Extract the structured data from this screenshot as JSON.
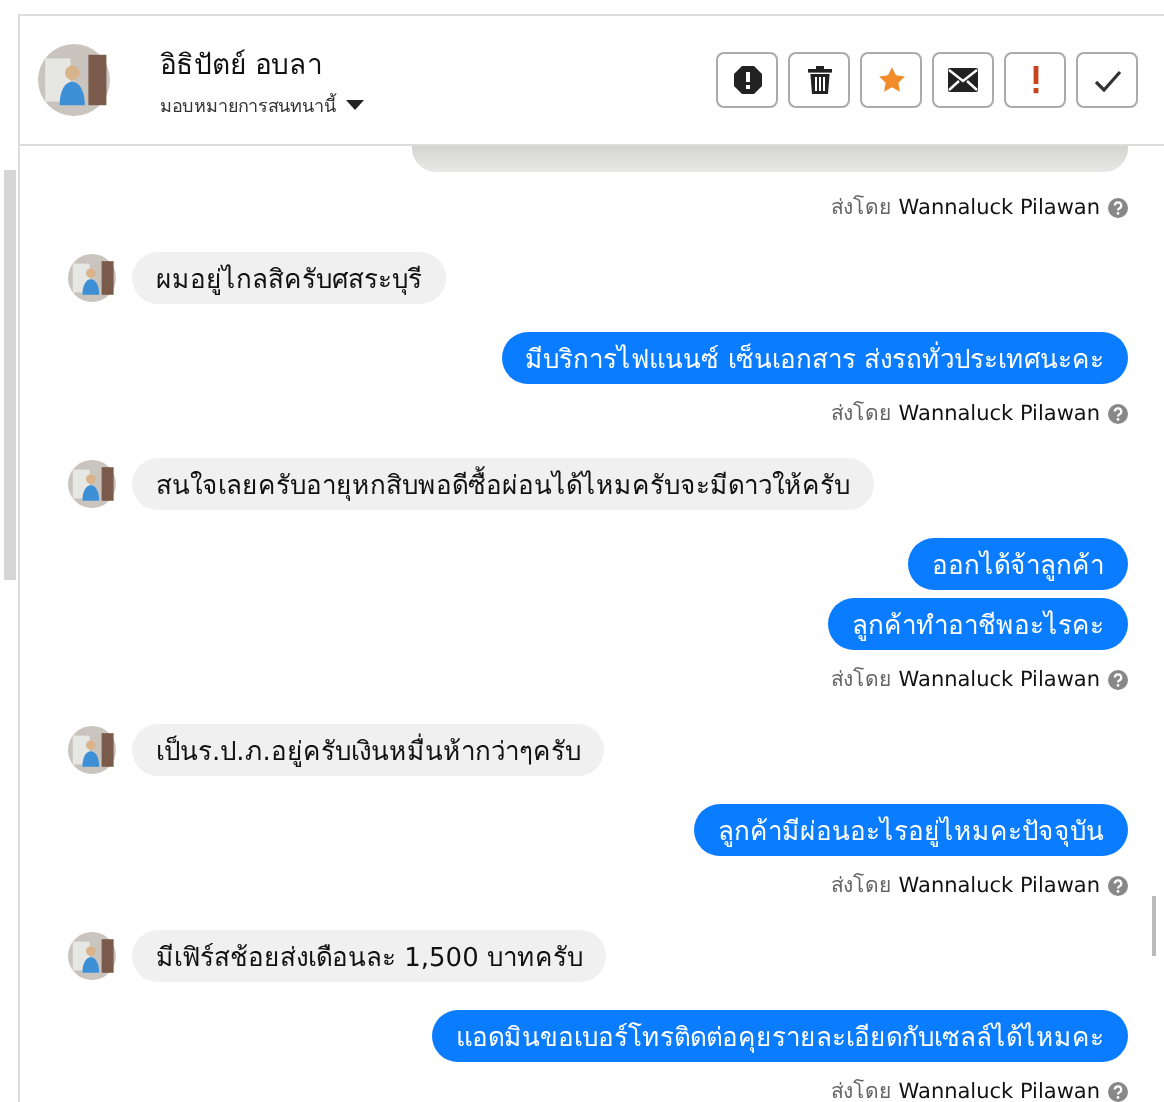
{
  "header": {
    "name": "อิธิปัตย์ อบลา",
    "subtitle": "มอบหมายการสนทนานี้",
    "actions": [
      {
        "kind": "report"
      },
      {
        "kind": "delete"
      },
      {
        "kind": "star"
      },
      {
        "kind": "mail"
      },
      {
        "kind": "alert"
      },
      {
        "kind": "done"
      }
    ]
  },
  "messages": [
    {
      "kind": "image"
    },
    {
      "kind": "sender",
      "prefix": "ส่งโดย",
      "name": "Wannaluck Pilawan"
    },
    {
      "kind": "incoming",
      "text": "ผมอยู่ไกลสิครับศสระบุรี"
    },
    {
      "kind": "outgoing",
      "text": "มีบริการไฟแนนซ์ เซ็นเอกสาร ส่งรถทั่วประเทศนะคะ"
    },
    {
      "kind": "sender",
      "prefix": "ส่งโดย",
      "name": "Wannaluck Pilawan"
    },
    {
      "kind": "incoming",
      "text": "สนใจเลยครับอายุหกสิบพอดีซื้อผ่อนได้ไหมครับจะมีดาวให้ครับ"
    },
    {
      "kind": "outgoing",
      "text": "ออกได้จ้าลูกค้า"
    },
    {
      "kind": "outgoing",
      "text": "ลูกค้าทำอาชีพอะไรคะ"
    },
    {
      "kind": "sender",
      "prefix": "ส่งโดย",
      "name": "Wannaluck Pilawan"
    },
    {
      "kind": "incoming",
      "text": "เป็นร.ป.ภ.อยู่ครับเงินหมื่นห้ากว่าๆครับ"
    },
    {
      "kind": "outgoing",
      "text": "ลูกค้ามีผ่อนอะไรอยู่ไหมคะปัจจุบัน"
    },
    {
      "kind": "sender",
      "prefix": "ส่งโดย",
      "name": "Wannaluck Pilawan"
    },
    {
      "kind": "incoming",
      "text": "มีเฟิร์สช้อยส่งเดือนละ 1,500 บาทครับ"
    },
    {
      "kind": "outgoing",
      "text": "แอดมินขอเบอร์โทรติดต่อคุยรายละเอียดกับเซลล์ได้ไหมคะ"
    },
    {
      "kind": "sender",
      "prefix": "ส่งโดย",
      "name": "Wannaluck Pilawan"
    }
  ]
}
